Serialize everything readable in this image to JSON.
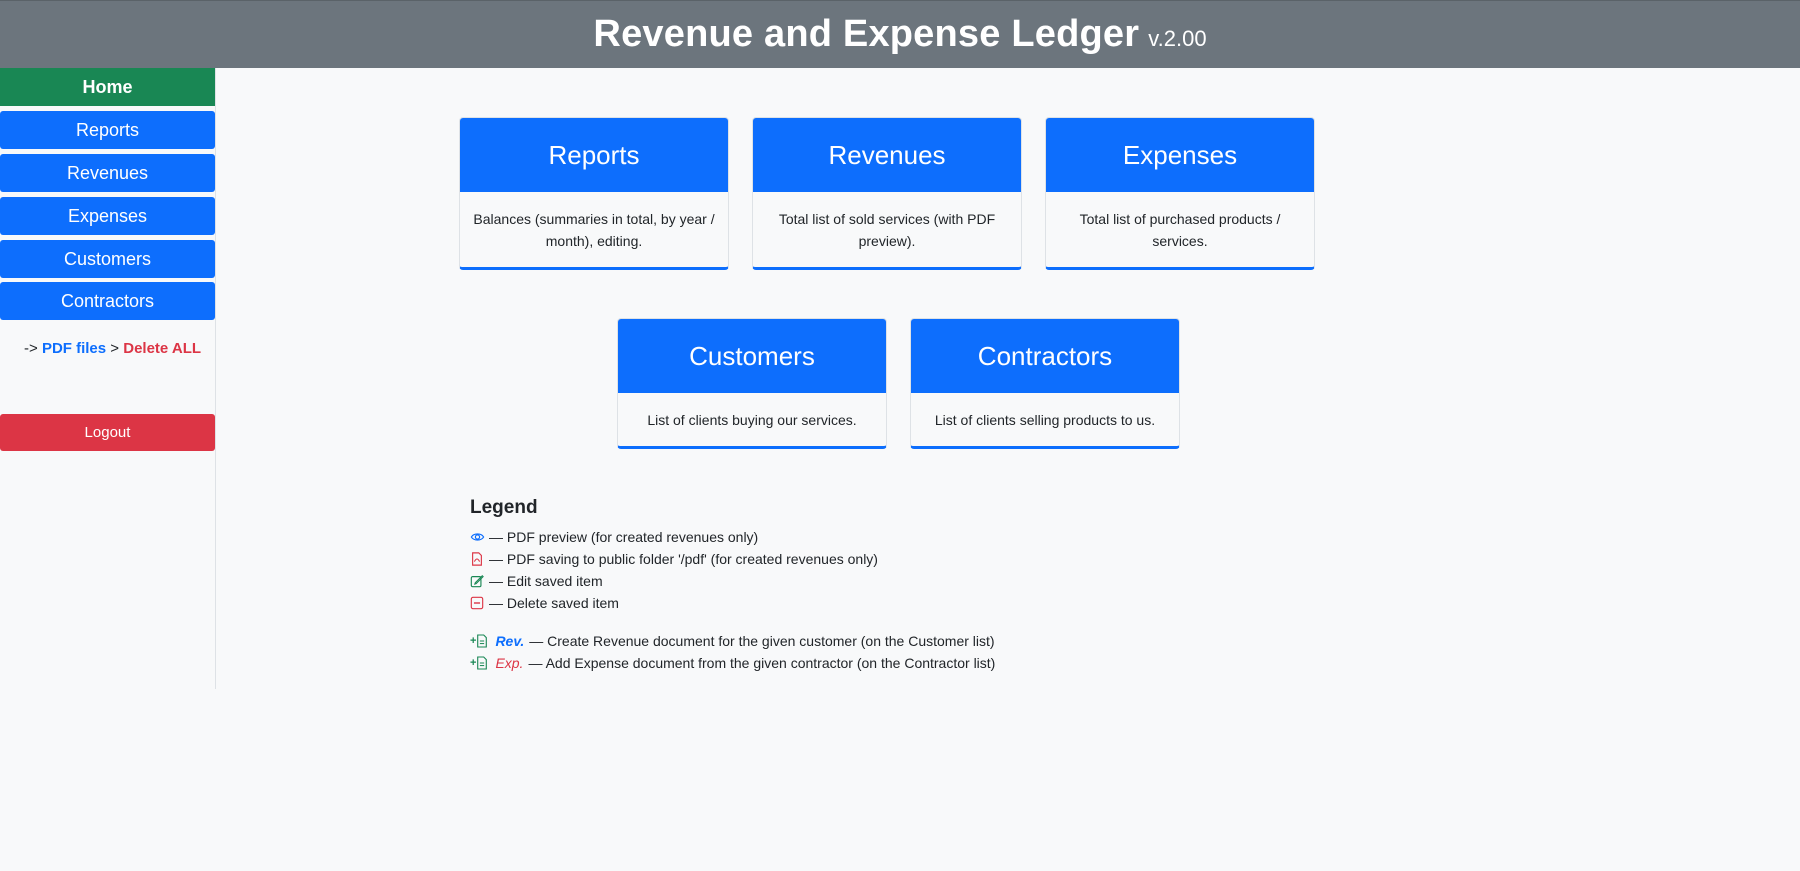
{
  "header": {
    "title": "Revenue and Expense Ledger",
    "version": "v.2.00"
  },
  "sidebar": {
    "items": [
      {
        "label": "Home"
      },
      {
        "label": "Reports"
      },
      {
        "label": "Revenues"
      },
      {
        "label": "Expenses"
      },
      {
        "label": "Customers"
      },
      {
        "label": "Contractors"
      }
    ],
    "links": {
      "arrow": "->",
      "pdf_files": "PDF files",
      "separator": ">",
      "delete_all": "Delete ALL"
    },
    "logout": "Logout"
  },
  "cards": [
    {
      "title": "Reports",
      "description": "Balances (summaries in total, by year / month), editing."
    },
    {
      "title": "Revenues",
      "description": "Total list of sold services (with PDF preview)."
    },
    {
      "title": "Expenses",
      "description": "Total list of purchased products / services."
    },
    {
      "title": "Customers",
      "description": "List of clients buying our services."
    },
    {
      "title": "Contractors",
      "description": "List of clients selling products to us."
    }
  ],
  "legend": {
    "title": "Legend",
    "items": [
      {
        "icon": "eye-icon",
        "text": "— PDF preview (for created revenues only)"
      },
      {
        "icon": "pdf-file-icon",
        "text": "— PDF saving to public folder '/pdf' (for created revenues only)"
      },
      {
        "icon": "edit-icon",
        "text": "— Edit saved item"
      },
      {
        "icon": "delete-icon",
        "text": "— Delete saved item"
      }
    ],
    "actions": [
      {
        "icon": "add-document-icon",
        "plus": "+",
        "tag": "Rev.",
        "text": "— Create Revenue document for the given customer (on the Customer list)"
      },
      {
        "icon": "add-document-icon",
        "plus": "+",
        "tag": "Exp.",
        "text": "— Add Expense document from the given contractor (on the Contractor list)"
      }
    ]
  },
  "colors": {
    "header": "#6c757d",
    "primary": "#0d6efd",
    "success": "#198754",
    "danger": "#dc3545",
    "background": "#f8f9fa"
  }
}
